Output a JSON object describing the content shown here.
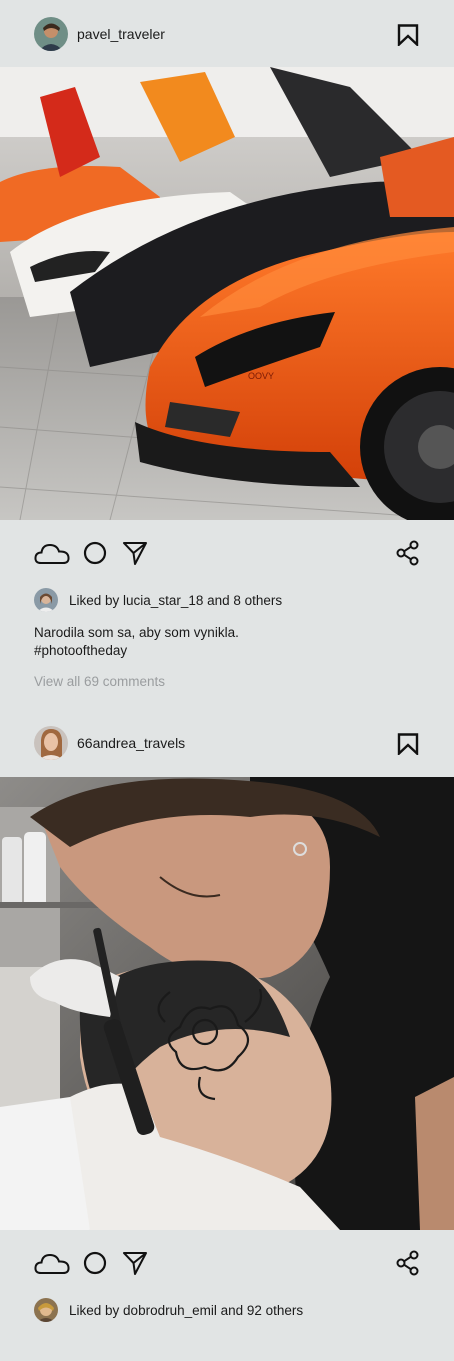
{
  "posts": [
    {
      "username": "pavel_traveler",
      "likes_prefix": "Liked by ",
      "likes_user": "lucia_star_18",
      "likes_suffix": " and 8 others",
      "caption_line1": "Narodila som sa, aby som vynikla.",
      "caption_line2": "#photooftheday",
      "view_comments": "View all 69 comments",
      "photo_subject": "orange sports car lineup in showroom",
      "colors": {
        "car": "#f05a12",
        "floor": "#b7b7b4"
      }
    },
    {
      "username": "66andrea_travels",
      "likes_prefix": "Liked by ",
      "likes_user": "dobrodruh_emil",
      "likes_suffix": " and 92 others",
      "photo_subject": "tattoo artist working on a head tattoo",
      "colors": {
        "shirt": "#141414",
        "glove": "#ece8e3"
      }
    }
  ],
  "icons": [
    "cloud-icon",
    "circle-icon",
    "send-icon",
    "share-icon",
    "bookmark-icon"
  ],
  "theme": {
    "background": "#e1e4e4",
    "text": "#1b1b1b",
    "muted": "#9a9d9f"
  }
}
